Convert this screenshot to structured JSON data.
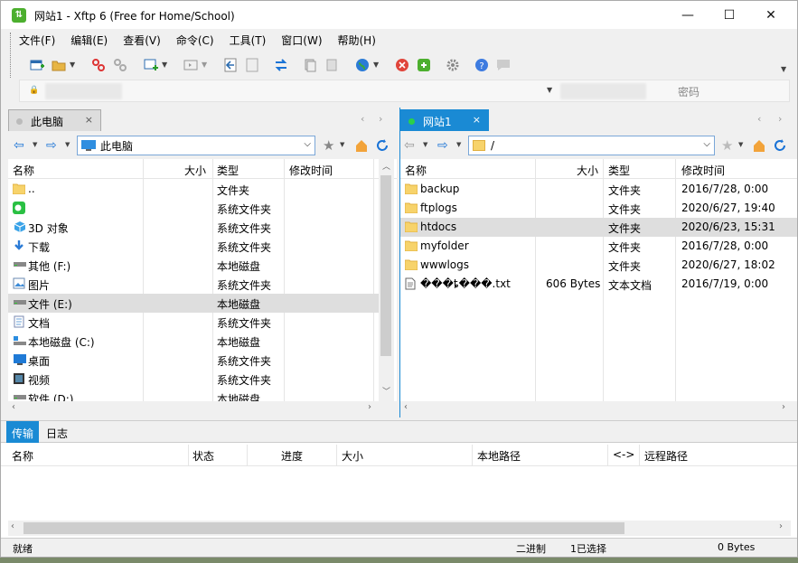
{
  "window": {
    "title": "网站1 - Xftp 6 (Free for Home/School)",
    "minimize": "—",
    "maximize": "☐",
    "close": "✕"
  },
  "menu": [
    "文件(F)",
    "编辑(E)",
    "查看(V)",
    "命令(C)",
    "工具(T)",
    "窗口(W)",
    "帮助(H)"
  ],
  "address": {
    "password_placeholder": "密码"
  },
  "left_pane": {
    "tab_label": "此电脑",
    "tab_close": "×",
    "path": "此电脑",
    "columns": [
      "名称",
      "大小",
      "类型",
      "修改时间"
    ],
    "rows": [
      {
        "name": "..",
        "size": "",
        "type": "文件夹",
        "modified": "",
        "icon": "folder-icon"
      },
      {
        "name": "",
        "size": "",
        "type": "系统文件夹",
        "modified": "",
        "icon": "wechat-icon"
      },
      {
        "name": "3D 对象",
        "size": "",
        "type": "系统文件夹",
        "modified": "",
        "icon": "3d-objects-icon"
      },
      {
        "name": "下载",
        "size": "",
        "type": "系统文件夹",
        "modified": "",
        "icon": "download-icon"
      },
      {
        "name": "其他 (F:)",
        "size": "",
        "type": "本地磁盘",
        "modified": "",
        "icon": "drive-icon"
      },
      {
        "name": "图片",
        "size": "",
        "type": "系统文件夹",
        "modified": "",
        "icon": "pictures-icon"
      },
      {
        "name": "文件 (E:)",
        "size": "",
        "type": "本地磁盘",
        "modified": "",
        "icon": "drive-icon",
        "selected": true
      },
      {
        "name": "文档",
        "size": "",
        "type": "系统文件夹",
        "modified": "",
        "icon": "documents-icon"
      },
      {
        "name": "本地磁盘 (C:)",
        "size": "",
        "type": "本地磁盘",
        "modified": "",
        "icon": "system-drive-icon"
      },
      {
        "name": "桌面",
        "size": "",
        "type": "系统文件夹",
        "modified": "",
        "icon": "desktop-icon"
      },
      {
        "name": "视频",
        "size": "",
        "type": "系统文件夹",
        "modified": "",
        "icon": "videos-icon"
      },
      {
        "name": "软件 (D:)",
        "size": "",
        "type": "本地磁盘",
        "modified": "",
        "icon": "drive-icon"
      }
    ]
  },
  "right_pane": {
    "tab_label": "网站1",
    "tab_close": "×",
    "path": "/",
    "columns": [
      "名称",
      "大小",
      "类型",
      "修改时间"
    ],
    "rows": [
      {
        "name": "backup",
        "size": "",
        "type": "文件夹",
        "modified": "2016/7/28, 0:00",
        "icon": "folder-icon"
      },
      {
        "name": "ftplogs",
        "size": "",
        "type": "文件夹",
        "modified": "2020/6/27, 19:40",
        "icon": "folder-icon"
      },
      {
        "name": "htdocs",
        "size": "",
        "type": "文件夹",
        "modified": "2020/6/23, 15:31",
        "icon": "folder-icon",
        "selected": true
      },
      {
        "name": "myfolder",
        "size": "",
        "type": "文件夹",
        "modified": "2016/7/28, 0:00",
        "icon": "folder-icon"
      },
      {
        "name": "wwwlogs",
        "size": "",
        "type": "文件夹",
        "modified": "2020/6/27, 18:02",
        "icon": "folder-icon"
      },
      {
        "name": "���ȶ���.txt",
        "size": "606 Bytes",
        "type": "文本文档",
        "modified": "2016/7/19, 0:00",
        "icon": "text-file-icon"
      }
    ]
  },
  "transfer": {
    "tabs": [
      "传输",
      "日志"
    ],
    "columns": [
      "名称",
      "状态",
      "进度",
      "大小",
      "本地路径",
      "<->",
      "远程路径"
    ]
  },
  "status": {
    "ready": "就绪",
    "mode": "二进制",
    "selected": "1已选择",
    "bytes": "0 Bytes"
  }
}
